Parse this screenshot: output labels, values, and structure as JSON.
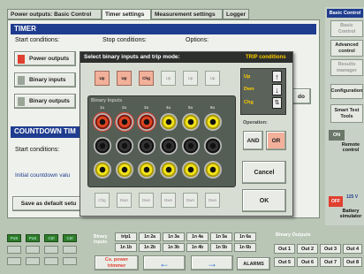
{
  "tabs": [
    "Power outputs: Basic Control",
    "Timer settings",
    "Measurement settings",
    "Logger"
  ],
  "timer": {
    "title": "TIMER",
    "start": "Start conditions:",
    "stop": "Stop conditions:",
    "options": "Options:",
    "power_outputs": "Power outputs",
    "binary_inputs": "Binary inputs",
    "binary_outputs": "Binary outputs",
    "do": "do"
  },
  "countdown": {
    "title": "COUNTDOWN TIM",
    "start": "Start conditions:",
    "initial": "Initial countdown valu"
  },
  "save_default": "Save as default setu",
  "sidebar": {
    "basic_control": "Basic Control",
    "basic": "Basic\nControl",
    "advanced": "Advanced\ncontrol",
    "results": "Results\nmanager",
    "configuration": "Configuration",
    "smart": "Smart Test\nTools",
    "on": "ON",
    "remote": "Remote\ncontrol",
    "off": "OFF",
    "voltage": "125 V",
    "battery": "Battery\nsimulator"
  },
  "dialog": {
    "title": "Select binary inputs and trip mode:",
    "trip": "TRIP conditions",
    "top_labels": [
      "Up",
      "Up",
      "Chg",
      "Up",
      "Up",
      "Up"
    ],
    "section": "Binary Inputs",
    "col_heads": [
      "1a",
      "2a",
      "3a",
      "4a",
      "5a",
      "6a"
    ],
    "bottom_labels": [
      "Chg",
      "Dwn",
      "Dwn",
      "Dwn",
      "Dwn",
      "Dwn"
    ],
    "up": "Up",
    "dwn": "Dwn",
    "chg": "Chg",
    "operation": "Operation:",
    "and": "AND",
    "or": "OR",
    "cancel": "Cancel",
    "ok": "OK"
  },
  "bottom": {
    "leds": [
      "PoS",
      "PoS",
      "Ctrl",
      "Ctrl"
    ],
    "binary_inputs_label": "Binary\ninputs",
    "bi": [
      "trip1",
      "1n 2a",
      "1n 3a",
      "1n 4a",
      "1n 5a",
      "1n 6a",
      "1n 1b",
      "1n 2b",
      "1n 3b",
      "1n 4b",
      "1n 5b",
      "1n 6b"
    ],
    "binary_outputs_label": "Binary Outputs",
    "bo": [
      "Out 1",
      "Out 2",
      "Out 3",
      "Out 4",
      "Out 5",
      "Out 6",
      "Out 7",
      "Out 8"
    ],
    "cs_power": "Cs. power\ntrimmer",
    "alarms": "ALARMS"
  },
  "colors": {
    "header": "#1f3d8f",
    "accent": "#f2b09a",
    "trip": "#ffcc00",
    "red": "#e04030"
  }
}
